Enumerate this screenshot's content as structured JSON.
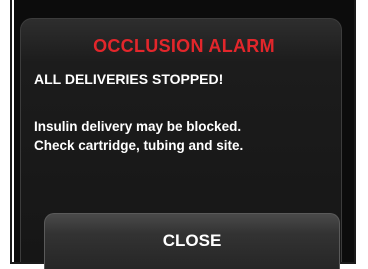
{
  "alarm": {
    "title": "OCCLUSION ALARM",
    "subtitle": "ALL DELIVERIES STOPPED!",
    "message_lines": [
      "Insulin delivery may be blocked.",
      "Check cartridge, tubing and site."
    ]
  },
  "actions": {
    "close_label": "CLOSE"
  },
  "colors": {
    "title": "#e3262b",
    "text": "#ffffff",
    "background": "#0c0c0c"
  }
}
